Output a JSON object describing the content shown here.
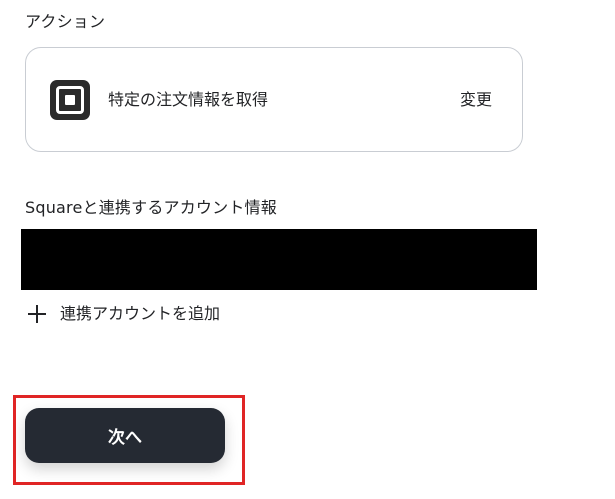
{
  "action_section": {
    "title": "アクション",
    "card": {
      "app_icon": "square-logo-icon",
      "label": "特定の注文情報を取得",
      "change_label": "変更"
    }
  },
  "account_section": {
    "title": "Squareと連携するアカウント情報",
    "redacted_value": "",
    "add_account_label": "連携アカウントを追加",
    "add_icon": "plus-icon"
  },
  "footer": {
    "next_label": "次へ",
    "highlight_color": "#e02525",
    "button_color": "#252a33"
  }
}
